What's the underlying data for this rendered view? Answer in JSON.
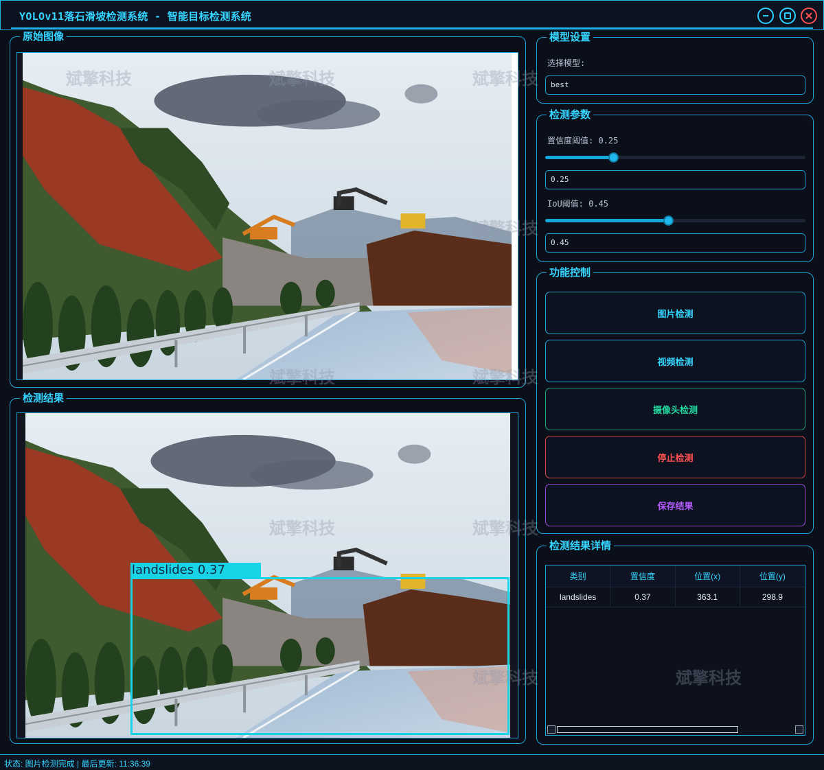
{
  "window": {
    "title": "YOLOv11落石滑坡检测系统 - 智能目标检测系统"
  },
  "watermark_text": "斌擎科技",
  "original_panel": {
    "label": "原始图像"
  },
  "result_panel": {
    "label": "检测结果",
    "detection_box": {
      "class": "landslides",
      "score": "0.37",
      "label_text": "landslides  0.37"
    }
  },
  "model_settings": {
    "label": "模型设置",
    "select_label": "选择模型:",
    "selected_model": "best"
  },
  "detect_params": {
    "label": "检测参数",
    "conf_label": "置信度阈值: 0.25",
    "conf_value": "0.25",
    "conf_fraction": 0.25,
    "iou_label": "IoU阈值: 0.45",
    "iou_value": "0.45",
    "iou_fraction": 0.45
  },
  "controls": {
    "label": "功能控制",
    "buttons": [
      {
        "label": "图片检测",
        "color": "#35d4ff"
      },
      {
        "label": "视频检测",
        "color": "#35d4ff"
      },
      {
        "label": "摄像头检测",
        "color": "#22d6a0"
      },
      {
        "label": "停止检测",
        "color": "#ff5050"
      },
      {
        "label": "保存结果",
        "color": "#b45cff"
      }
    ]
  },
  "details": {
    "label": "检测结果详情",
    "columns": [
      "类别",
      "置信度",
      "位置(x)",
      "位置(y)"
    ],
    "rows": [
      [
        "landslides",
        "0.37",
        "363.1",
        "298.9"
      ]
    ]
  },
  "status": {
    "text": "状态: 图片检测完成 | 最后更新: 11:36:39"
  },
  "colors": {
    "accent": "#1fb7ee",
    "background": "#0b0f1a",
    "box": "#19d3e6"
  }
}
